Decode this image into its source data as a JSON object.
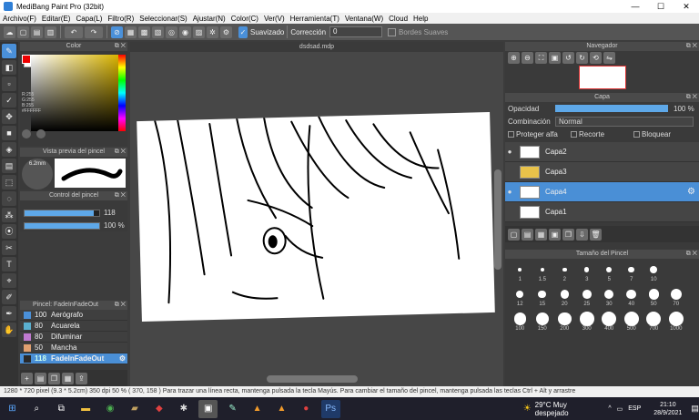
{
  "window": {
    "title": "MediBang Paint Pro (32bit)",
    "minimize": "—",
    "maximize": "☐",
    "close": "✕"
  },
  "menu": [
    "Archivo(F)",
    "Editar(E)",
    "Capa(L)",
    "Filtro(R)",
    "Seleccionar(S)",
    "Ajustar(N)",
    "Color(C)",
    "Ver(V)",
    "Herramienta(T)",
    "Ventana(W)",
    "Cloud",
    "Help"
  ],
  "toolbar": {
    "smoothing_label": "Suavizado",
    "correction_label": "Corrección",
    "correction_value": "0",
    "soft_edges_label": "Bordes Suaves"
  },
  "color_panel": {
    "title": "Color",
    "r": "R:255",
    "g": "G:255",
    "b": "B:255",
    "hex": "#FFFFFF"
  },
  "brush_preview": {
    "title": "Vista previa del pincel",
    "size": "6.2mm"
  },
  "brush_control": {
    "title": "Control del pincel",
    "size_value": "118",
    "opacity_value": "100 %",
    "size_fraction": 0.93,
    "opacity_fraction": 1.0
  },
  "brush_list": {
    "title": "Pincel: FadeInFadeOut",
    "items": [
      {
        "size": "100",
        "name": "Aerógrafo",
        "color": "#4a90d9"
      },
      {
        "size": "80",
        "name": "Acuarela",
        "color": "#5ab0d0"
      },
      {
        "size": "80",
        "name": "Difuminar",
        "color": "#c07ad0"
      },
      {
        "size": "50",
        "name": "Mancha",
        "color": "#e0a070"
      },
      {
        "size": "118",
        "name": "FadeInFadeOut",
        "color": "#2a2a2a",
        "selected": true
      }
    ]
  },
  "document": {
    "tab": "dsdsad.mdp"
  },
  "navigator": {
    "title": "Navegador"
  },
  "layer_panel": {
    "title": "Capa",
    "opacity_label": "Opacidad",
    "opacity_value": "100 %",
    "blend_label": "Combinación",
    "blend_value": "Normal",
    "protect_alpha": "Proteger alfa",
    "clip": "Recorte",
    "lock": "Bloquear",
    "layers": [
      {
        "name": "Capa2",
        "visible": true,
        "selected": false
      },
      {
        "name": "Capa3",
        "visible": false,
        "selected": false
      },
      {
        "name": "Capa4",
        "visible": true,
        "selected": true
      },
      {
        "name": "Capa1",
        "visible": false,
        "selected": false
      }
    ]
  },
  "brush_size_panel": {
    "title": "Tamaño del Pincel",
    "sizes": [
      "1",
      "1.5",
      "2",
      "3",
      "5",
      "7",
      "10",
      "12",
      "15",
      "20",
      "25",
      "30",
      "40",
      "50",
      "70",
      "100",
      "150",
      "200",
      "300",
      "400",
      "500",
      "700",
      "1000"
    ]
  },
  "status": {
    "text": "1280 * 720 pixel   (9.3 * 5.2cm)   350 dpi   50 %   ( 370, 158 )   Para trazar una línea recta, mantenga pulsada la tecla Mayús. Para cambiar el tamaño del pincel, mantenga pulsada las teclas Ctrl + Alt y arrastre"
  },
  "taskbar": {
    "weather": "29°C  Muy despejado",
    "lang": "ESP",
    "time": "21:10",
    "date": "28/9/2021"
  }
}
